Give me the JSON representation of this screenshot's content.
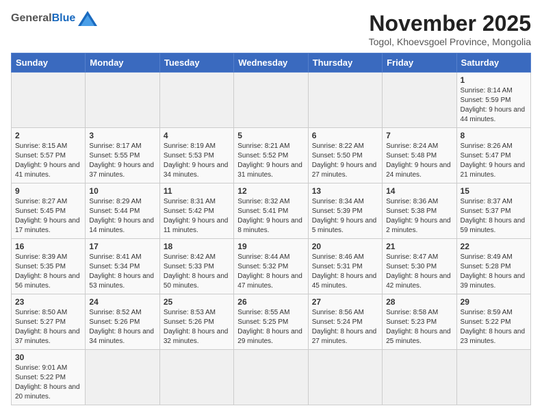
{
  "header": {
    "logo_general": "General",
    "logo_blue": "Blue",
    "month_title": "November 2025",
    "subtitle": "Togol, Khoevsgoel Province, Mongolia"
  },
  "weekdays": [
    "Sunday",
    "Monday",
    "Tuesday",
    "Wednesday",
    "Thursday",
    "Friday",
    "Saturday"
  ],
  "weeks": [
    [
      {
        "day": "",
        "info": ""
      },
      {
        "day": "",
        "info": ""
      },
      {
        "day": "",
        "info": ""
      },
      {
        "day": "",
        "info": ""
      },
      {
        "day": "",
        "info": ""
      },
      {
        "day": "",
        "info": ""
      },
      {
        "day": "1",
        "info": "Sunrise: 8:14 AM\nSunset: 5:59 PM\nDaylight: 9 hours\nand 44 minutes."
      }
    ],
    [
      {
        "day": "2",
        "info": "Sunrise: 8:15 AM\nSunset: 5:57 PM\nDaylight: 9 hours\nand 41 minutes."
      },
      {
        "day": "3",
        "info": "Sunrise: 8:17 AM\nSunset: 5:55 PM\nDaylight: 9 hours\nand 37 minutes."
      },
      {
        "day": "4",
        "info": "Sunrise: 8:19 AM\nSunset: 5:53 PM\nDaylight: 9 hours\nand 34 minutes."
      },
      {
        "day": "5",
        "info": "Sunrise: 8:21 AM\nSunset: 5:52 PM\nDaylight: 9 hours\nand 31 minutes."
      },
      {
        "day": "6",
        "info": "Sunrise: 8:22 AM\nSunset: 5:50 PM\nDaylight: 9 hours\nand 27 minutes."
      },
      {
        "day": "7",
        "info": "Sunrise: 8:24 AM\nSunset: 5:48 PM\nDaylight: 9 hours\nand 24 minutes."
      },
      {
        "day": "8",
        "info": "Sunrise: 8:26 AM\nSunset: 5:47 PM\nDaylight: 9 hours\nand 21 minutes."
      }
    ],
    [
      {
        "day": "9",
        "info": "Sunrise: 8:27 AM\nSunset: 5:45 PM\nDaylight: 9 hours\nand 17 minutes."
      },
      {
        "day": "10",
        "info": "Sunrise: 8:29 AM\nSunset: 5:44 PM\nDaylight: 9 hours\nand 14 minutes."
      },
      {
        "day": "11",
        "info": "Sunrise: 8:31 AM\nSunset: 5:42 PM\nDaylight: 9 hours\nand 11 minutes."
      },
      {
        "day": "12",
        "info": "Sunrise: 8:32 AM\nSunset: 5:41 PM\nDaylight: 9 hours\nand 8 minutes."
      },
      {
        "day": "13",
        "info": "Sunrise: 8:34 AM\nSunset: 5:39 PM\nDaylight: 9 hours\nand 5 minutes."
      },
      {
        "day": "14",
        "info": "Sunrise: 8:36 AM\nSunset: 5:38 PM\nDaylight: 9 hours\nand 2 minutes."
      },
      {
        "day": "15",
        "info": "Sunrise: 8:37 AM\nSunset: 5:37 PM\nDaylight: 8 hours\nand 59 minutes."
      }
    ],
    [
      {
        "day": "16",
        "info": "Sunrise: 8:39 AM\nSunset: 5:35 PM\nDaylight: 8 hours\nand 56 minutes."
      },
      {
        "day": "17",
        "info": "Sunrise: 8:41 AM\nSunset: 5:34 PM\nDaylight: 8 hours\nand 53 minutes."
      },
      {
        "day": "18",
        "info": "Sunrise: 8:42 AM\nSunset: 5:33 PM\nDaylight: 8 hours\nand 50 minutes."
      },
      {
        "day": "19",
        "info": "Sunrise: 8:44 AM\nSunset: 5:32 PM\nDaylight: 8 hours\nand 47 minutes."
      },
      {
        "day": "20",
        "info": "Sunrise: 8:46 AM\nSunset: 5:31 PM\nDaylight: 8 hours\nand 45 minutes."
      },
      {
        "day": "21",
        "info": "Sunrise: 8:47 AM\nSunset: 5:30 PM\nDaylight: 8 hours\nand 42 minutes."
      },
      {
        "day": "22",
        "info": "Sunrise: 8:49 AM\nSunset: 5:28 PM\nDaylight: 8 hours\nand 39 minutes."
      }
    ],
    [
      {
        "day": "23",
        "info": "Sunrise: 8:50 AM\nSunset: 5:27 PM\nDaylight: 8 hours\nand 37 minutes."
      },
      {
        "day": "24",
        "info": "Sunrise: 8:52 AM\nSunset: 5:26 PM\nDaylight: 8 hours\nand 34 minutes."
      },
      {
        "day": "25",
        "info": "Sunrise: 8:53 AM\nSunset: 5:26 PM\nDaylight: 8 hours\nand 32 minutes."
      },
      {
        "day": "26",
        "info": "Sunrise: 8:55 AM\nSunset: 5:25 PM\nDaylight: 8 hours\nand 29 minutes."
      },
      {
        "day": "27",
        "info": "Sunrise: 8:56 AM\nSunset: 5:24 PM\nDaylight: 8 hours\nand 27 minutes."
      },
      {
        "day": "28",
        "info": "Sunrise: 8:58 AM\nSunset: 5:23 PM\nDaylight: 8 hours\nand 25 minutes."
      },
      {
        "day": "29",
        "info": "Sunrise: 8:59 AM\nSunset: 5:22 PM\nDaylight: 8 hours\nand 23 minutes."
      }
    ],
    [
      {
        "day": "30",
        "info": "Sunrise: 9:01 AM\nSunset: 5:22 PM\nDaylight: 8 hours\nand 20 minutes."
      },
      {
        "day": "",
        "info": ""
      },
      {
        "day": "",
        "info": ""
      },
      {
        "day": "",
        "info": ""
      },
      {
        "day": "",
        "info": ""
      },
      {
        "day": "",
        "info": ""
      },
      {
        "day": "",
        "info": ""
      }
    ]
  ]
}
